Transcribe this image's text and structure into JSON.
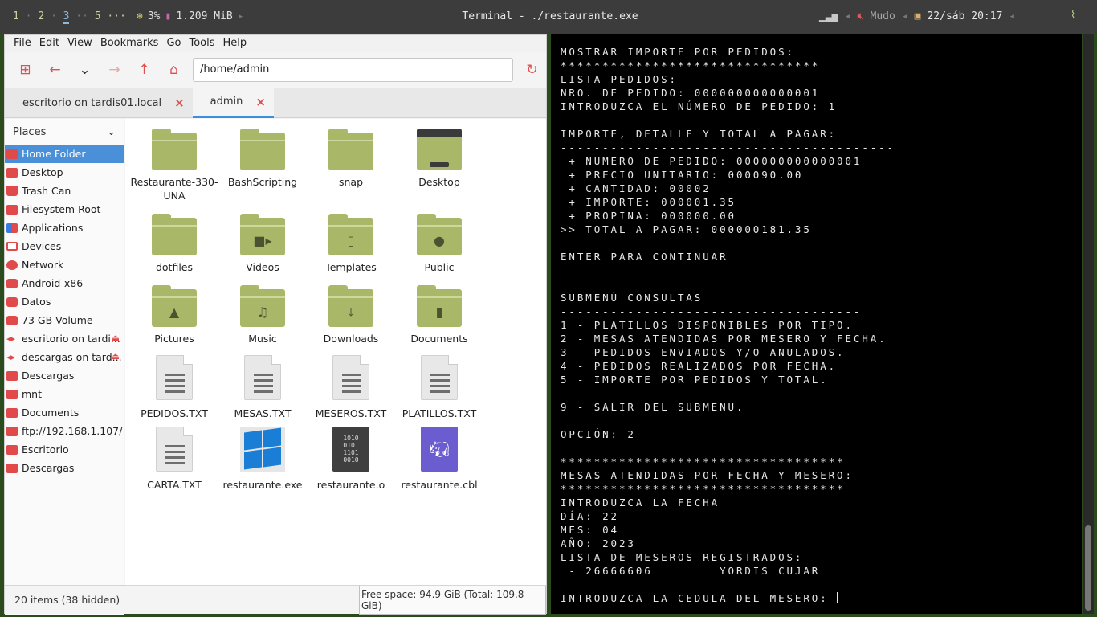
{
  "topbar": {
    "workspaces": [
      {
        "label": "1",
        "active": false
      },
      {
        "label": "2",
        "active": false
      },
      {
        "label": "3",
        "active": true
      },
      {
        "label": "5",
        "active": false
      }
    ],
    "ws_more": "···",
    "cpu": "3%",
    "mem": "1.209 MiB",
    "window_title": "Terminal - ./restaurante.exe",
    "volume_label": "Mudo",
    "datetime": "22/sáb 20:17"
  },
  "file_manager": {
    "menu": [
      "File",
      "Edit",
      "View",
      "Bookmarks",
      "Go",
      "Tools",
      "Help"
    ],
    "path": "/home/admin",
    "tabs": [
      {
        "label": "escritorio on tardis01.local",
        "active": false
      },
      {
        "label": "admin",
        "active": true
      }
    ],
    "places_label": "Places",
    "places": [
      {
        "label": "Home Folder",
        "icon": "home-icon",
        "selected": true
      },
      {
        "label": "Desktop",
        "icon": "desktop-icon"
      },
      {
        "label": "Trash Can",
        "icon": "trash-icon"
      },
      {
        "label": "Filesystem Root",
        "icon": "drive-icon"
      },
      {
        "label": "Applications",
        "icon": "applications-icon"
      },
      {
        "label": "Devices",
        "icon": "devices-icon"
      },
      {
        "label": "Network",
        "icon": "network-icon"
      },
      {
        "label": "Android-x86",
        "icon": "disk-icon"
      },
      {
        "label": "Datos",
        "icon": "disk-icon"
      },
      {
        "label": "73 GB Volume",
        "icon": "disk-icon"
      },
      {
        "label": "escritorio on tardi...",
        "icon": "share-icon",
        "eject": true
      },
      {
        "label": "descargas on tard...",
        "icon": "share-icon",
        "eject": true
      },
      {
        "label": "Descargas",
        "icon": "folder-icon"
      },
      {
        "label": "mnt",
        "icon": "folder-icon"
      },
      {
        "label": "Documents",
        "icon": "folder-icon"
      },
      {
        "label": "ftp://192.168.1.107/",
        "icon": "folder-icon"
      },
      {
        "label": "Escritorio",
        "icon": "folder-icon"
      },
      {
        "label": "Descargas",
        "icon": "folder-icon"
      }
    ],
    "items": [
      {
        "label": "Restaurante-330-UNA",
        "kind": "folder"
      },
      {
        "label": "BashScripting",
        "kind": "folder"
      },
      {
        "label": "snap",
        "kind": "folder"
      },
      {
        "label": "Desktop",
        "kind": "desktop"
      },
      {
        "label": "dotfiles",
        "kind": "folder"
      },
      {
        "label": "Videos",
        "kind": "folder-videos"
      },
      {
        "label": "Templates",
        "kind": "folder-templates"
      },
      {
        "label": "Public",
        "kind": "folder-public"
      },
      {
        "label": "Pictures",
        "kind": "folder-pictures"
      },
      {
        "label": "Music",
        "kind": "folder-music"
      },
      {
        "label": "Downloads",
        "kind": "folder-downloads"
      },
      {
        "label": "Documents",
        "kind": "folder-documents"
      },
      {
        "label": "PEDIDOS.TXT",
        "kind": "text"
      },
      {
        "label": "MESAS.TXT",
        "kind": "text"
      },
      {
        "label": "MESEROS.TXT",
        "kind": "text"
      },
      {
        "label": "PLATILLOS.TXT",
        "kind": "text"
      },
      {
        "label": "CARTA.TXT",
        "kind": "text"
      },
      {
        "label": "restaurante.exe",
        "kind": "exe"
      },
      {
        "label": "restaurante.o",
        "kind": "object"
      },
      {
        "label": "restaurante.cbl",
        "kind": "cobol"
      }
    ],
    "status_count": "20 items (38 hidden)",
    "status_free": "Free space: 94.9 GiB (Total: 109.8 GiB)"
  },
  "terminal": {
    "lines": [
      "MOSTRAR IMPORTE POR PEDIDOS:",
      "*******************************",
      "LISTA PEDIDOS:",
      "NRO. DE PEDIDO: 000000000000001",
      "INTRODUZCA EL NÚMERO DE PEDIDO: 1",
      "",
      "IMPORTE, DETALLE Y TOTAL A PAGAR:",
      "----------------------------------------",
      " + NUMERO DE PEDIDO: 000000000000001",
      " + PRECIO UNITARIO: 000090.00",
      " + CANTIDAD: 00002",
      " + IMPORTE: 000001.35",
      " + PROPINA: 000000.00",
      ">> TOTAL A PAGAR: 000000181.35",
      "",
      "ENTER PARA CONTINUAR",
      "",
      "",
      "SUBMENÚ CONSULTAS",
      "------------------------------------",
      "1 - PLATILLOS DISPONIBLES POR TIPO.",
      "2 - MESAS ATENDIDAS POR MESERO Y FECHA.",
      "3 - PEDIDOS ENVIADOS Y/O ANULADOS.",
      "4 - PEDIDOS REALIZADOS POR FECHA.",
      "5 - IMPORTE POR PEDIDOS Y TOTAL.",
      "------------------------------------",
      "9 - SALIR DEL SUBMENU.",
      "",
      "OPCIÓN: 2",
      "",
      "**********************************",
      "MESAS ATENDIDAS POR FECHA Y MESERO:",
      "**********************************",
      "INTRODUZCA LA FECHA",
      "DÍA: 22",
      "MES: 04",
      "AÑO: 2023",
      "LISTA DE MESEROS REGISTRADOS:",
      " - 26666606        YORDIS CUJAR",
      "",
      "INTRODUZCA LA CEDULA DEL MESERO: "
    ]
  }
}
